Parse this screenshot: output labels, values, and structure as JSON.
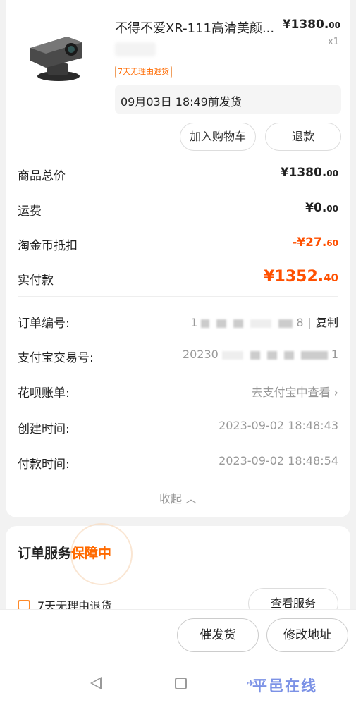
{
  "product": {
    "title": "不得不爱XR-111高清美颜...",
    "price_int": "¥1380.",
    "price_dec": "00",
    "qty": "x1",
    "return_tag": "7天无理由退货",
    "ship_notice": "09月03日 18:49前发货",
    "add_cart_label": "加入购物车",
    "refund_label": "退款"
  },
  "summary": {
    "goods_total_label": "商品总价",
    "goods_total_int": "¥1380.",
    "goods_total_dec": "00",
    "shipping_label": "运费",
    "shipping_int": "¥0.",
    "shipping_dec": "00",
    "coins_label": "淘金币抵扣",
    "coins_int": "-¥27.",
    "coins_dec": "60",
    "paid_label": "实付款",
    "paid_int": "¥1352.",
    "paid_dec": "40"
  },
  "info": {
    "order_no_label": "订单编号:",
    "order_no_head": "1",
    "order_no_tail": "8",
    "copy_label": "复制",
    "alipay_label": "支付宝交易号:",
    "alipay_head": "20230",
    "alipay_tail": "1",
    "huabei_label": "花呗账单:",
    "huabei_value": "去支付宝中查看",
    "created_label": "创建时间:",
    "created_value": "2023-09-02 18:48:43",
    "paid_time_label": "付款时间:",
    "paid_time_value": "2023-09-02 18:48:54",
    "collapse_label": "收起"
  },
  "service": {
    "title": "订单服务",
    "status": "保障中",
    "item": "7天无理由退货",
    "view_label": "查看服务"
  },
  "actions": {
    "urge_label": "催发货",
    "address_label": "修改地址"
  },
  "watermark": "平邑在线",
  "colors": {
    "accent": "#ff5000",
    "tag": "#ff6a00",
    "watermark": "#7c92e6"
  }
}
